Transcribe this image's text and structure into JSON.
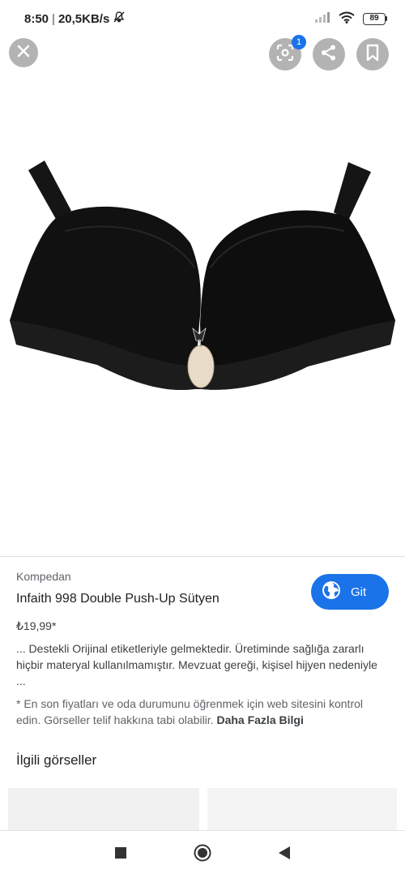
{
  "status_bar": {
    "time": "8:50",
    "separator": "|",
    "speed": "20,5KB/s",
    "battery": "89"
  },
  "toolbar": {
    "lens_badge": "1"
  },
  "product": {
    "source": "Kompedan",
    "title": "Infaith 998 Double Push-Up Sütyen",
    "price": "₺19,99*",
    "description": "... Destekli Orijinal etiketleriyle gelmektedir. Üretiminde sağlığa zararlı hiçbir materyal kullanılmamıştır. Mevzuat gereği, kişisel hijyen nedeniyle ...",
    "notice": "* En son fiyatları ve oda durumunu öğrenmek için web sitesini kontrol edin. Görseller telif hakkına tabi olabilir.",
    "more_info": "Daha Fazla Bilgi",
    "visit_label": "Git"
  },
  "related": {
    "title": "İlgili görseller"
  },
  "colors": {
    "accent": "#1a73e8",
    "overlay_button": "#b3b3b3"
  }
}
